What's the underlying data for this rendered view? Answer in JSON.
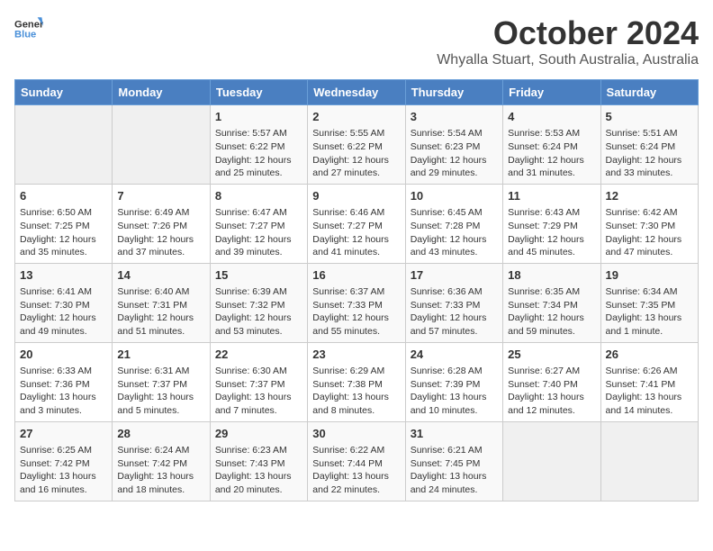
{
  "logo": {
    "line1": "General",
    "line2": "Blue"
  },
  "title": "October 2024",
  "location": "Whyalla Stuart, South Australia, Australia",
  "days_of_week": [
    "Sunday",
    "Monday",
    "Tuesday",
    "Wednesday",
    "Thursday",
    "Friday",
    "Saturday"
  ],
  "weeks": [
    [
      {
        "day": "",
        "info": ""
      },
      {
        "day": "",
        "info": ""
      },
      {
        "day": "1",
        "info": "Sunrise: 5:57 AM\nSunset: 6:22 PM\nDaylight: 12 hours and 25 minutes."
      },
      {
        "day": "2",
        "info": "Sunrise: 5:55 AM\nSunset: 6:22 PM\nDaylight: 12 hours and 27 minutes."
      },
      {
        "day": "3",
        "info": "Sunrise: 5:54 AM\nSunset: 6:23 PM\nDaylight: 12 hours and 29 minutes."
      },
      {
        "day": "4",
        "info": "Sunrise: 5:53 AM\nSunset: 6:24 PM\nDaylight: 12 hours and 31 minutes."
      },
      {
        "day": "5",
        "info": "Sunrise: 5:51 AM\nSunset: 6:24 PM\nDaylight: 12 hours and 33 minutes."
      }
    ],
    [
      {
        "day": "6",
        "info": "Sunrise: 6:50 AM\nSunset: 7:25 PM\nDaylight: 12 hours and 35 minutes."
      },
      {
        "day": "7",
        "info": "Sunrise: 6:49 AM\nSunset: 7:26 PM\nDaylight: 12 hours and 37 minutes."
      },
      {
        "day": "8",
        "info": "Sunrise: 6:47 AM\nSunset: 7:27 PM\nDaylight: 12 hours and 39 minutes."
      },
      {
        "day": "9",
        "info": "Sunrise: 6:46 AM\nSunset: 7:27 PM\nDaylight: 12 hours and 41 minutes."
      },
      {
        "day": "10",
        "info": "Sunrise: 6:45 AM\nSunset: 7:28 PM\nDaylight: 12 hours and 43 minutes."
      },
      {
        "day": "11",
        "info": "Sunrise: 6:43 AM\nSunset: 7:29 PM\nDaylight: 12 hours and 45 minutes."
      },
      {
        "day": "12",
        "info": "Sunrise: 6:42 AM\nSunset: 7:30 PM\nDaylight: 12 hours and 47 minutes."
      }
    ],
    [
      {
        "day": "13",
        "info": "Sunrise: 6:41 AM\nSunset: 7:30 PM\nDaylight: 12 hours and 49 minutes."
      },
      {
        "day": "14",
        "info": "Sunrise: 6:40 AM\nSunset: 7:31 PM\nDaylight: 12 hours and 51 minutes."
      },
      {
        "day": "15",
        "info": "Sunrise: 6:39 AM\nSunset: 7:32 PM\nDaylight: 12 hours and 53 minutes."
      },
      {
        "day": "16",
        "info": "Sunrise: 6:37 AM\nSunset: 7:33 PM\nDaylight: 12 hours and 55 minutes."
      },
      {
        "day": "17",
        "info": "Sunrise: 6:36 AM\nSunset: 7:33 PM\nDaylight: 12 hours and 57 minutes."
      },
      {
        "day": "18",
        "info": "Sunrise: 6:35 AM\nSunset: 7:34 PM\nDaylight: 12 hours and 59 minutes."
      },
      {
        "day": "19",
        "info": "Sunrise: 6:34 AM\nSunset: 7:35 PM\nDaylight: 13 hours and 1 minute."
      }
    ],
    [
      {
        "day": "20",
        "info": "Sunrise: 6:33 AM\nSunset: 7:36 PM\nDaylight: 13 hours and 3 minutes."
      },
      {
        "day": "21",
        "info": "Sunrise: 6:31 AM\nSunset: 7:37 PM\nDaylight: 13 hours and 5 minutes."
      },
      {
        "day": "22",
        "info": "Sunrise: 6:30 AM\nSunset: 7:37 PM\nDaylight: 13 hours and 7 minutes."
      },
      {
        "day": "23",
        "info": "Sunrise: 6:29 AM\nSunset: 7:38 PM\nDaylight: 13 hours and 8 minutes."
      },
      {
        "day": "24",
        "info": "Sunrise: 6:28 AM\nSunset: 7:39 PM\nDaylight: 13 hours and 10 minutes."
      },
      {
        "day": "25",
        "info": "Sunrise: 6:27 AM\nSunset: 7:40 PM\nDaylight: 13 hours and 12 minutes."
      },
      {
        "day": "26",
        "info": "Sunrise: 6:26 AM\nSunset: 7:41 PM\nDaylight: 13 hours and 14 minutes."
      }
    ],
    [
      {
        "day": "27",
        "info": "Sunrise: 6:25 AM\nSunset: 7:42 PM\nDaylight: 13 hours and 16 minutes."
      },
      {
        "day": "28",
        "info": "Sunrise: 6:24 AM\nSunset: 7:42 PM\nDaylight: 13 hours and 18 minutes."
      },
      {
        "day": "29",
        "info": "Sunrise: 6:23 AM\nSunset: 7:43 PM\nDaylight: 13 hours and 20 minutes."
      },
      {
        "day": "30",
        "info": "Sunrise: 6:22 AM\nSunset: 7:44 PM\nDaylight: 13 hours and 22 minutes."
      },
      {
        "day": "31",
        "info": "Sunrise: 6:21 AM\nSunset: 7:45 PM\nDaylight: 13 hours and 24 minutes."
      },
      {
        "day": "",
        "info": ""
      },
      {
        "day": "",
        "info": ""
      }
    ]
  ]
}
